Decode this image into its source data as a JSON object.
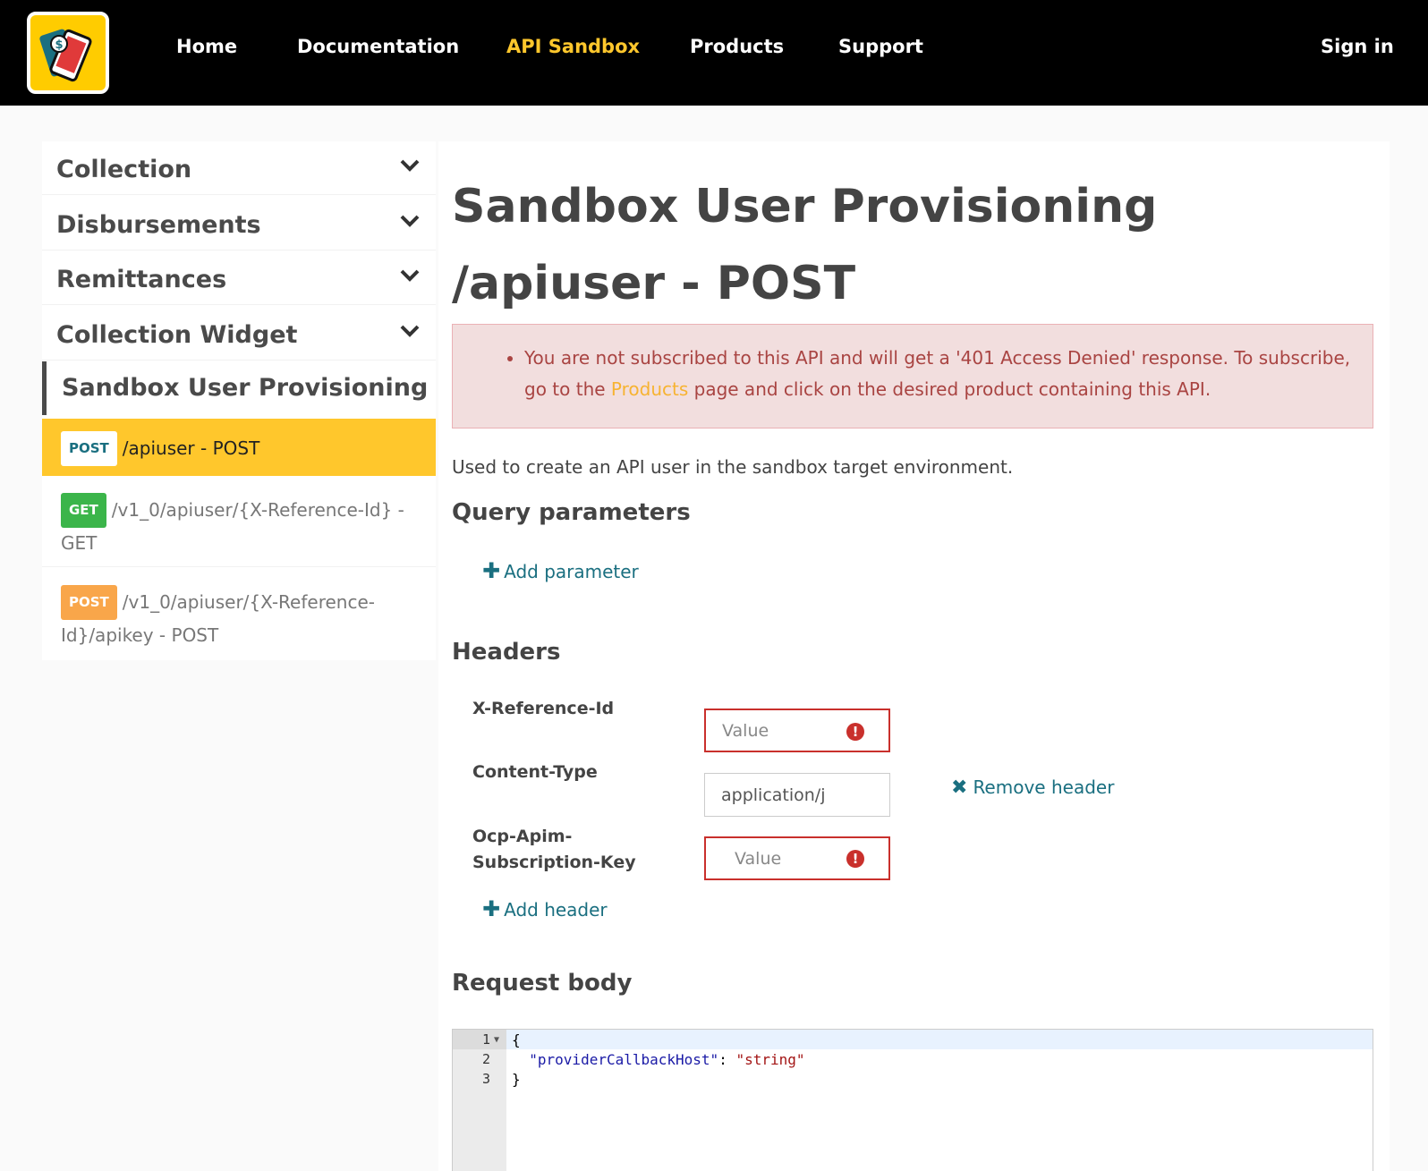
{
  "nav": {
    "items": [
      {
        "label": "Home",
        "active": false
      },
      {
        "label": "Documentation",
        "active": false
      },
      {
        "label": "API Sandbox",
        "active": true
      },
      {
        "label": "Products",
        "active": false
      },
      {
        "label": "Support",
        "active": false
      }
    ],
    "sign_in": "Sign in",
    "active_color": "#ffc72c"
  },
  "sidebar": {
    "groups": [
      {
        "label": "Collection",
        "icon": "chevron-down-icon"
      },
      {
        "label": "Disbursements",
        "icon": "chevron-down-icon"
      },
      {
        "label": "Remittances",
        "icon": "chevron-down-icon"
      },
      {
        "label": "Collection Widget",
        "icon": "chevron-down-icon"
      }
    ],
    "current_group": "Sandbox User Provisioning",
    "operations": [
      {
        "method": "POST",
        "path": "/apiuser - POST",
        "selected": true
      },
      {
        "method": "GET",
        "path": "/v1_0/apiuser/{X-Reference-Id} - GET",
        "selected": false
      },
      {
        "method": "POST",
        "path": "/v1_0/apiuser/{X-Reference-Id}/apikey - POST",
        "selected": false
      }
    ]
  },
  "main": {
    "title": "Sandbox User Provisioning /apiuser - POST",
    "alert": {
      "before": "You are not subscribed to this API and will get a '401 Access Denied' response. To subscribe, go to the ",
      "link": "Products",
      "after": " page and click on the desired product containing this API."
    },
    "description": "Used to create an API user in the sandbox target environment.",
    "query_heading": "Query parameters",
    "add_parameter": "Add parameter",
    "headers_heading": "Headers",
    "headers": [
      {
        "name": "X-Reference-Id",
        "value": "",
        "placeholder": "Value",
        "error": true
      },
      {
        "name": "Content-Type",
        "value": "application/j",
        "placeholder": "",
        "error": false
      },
      {
        "name": "Ocp-Apim-Subscription-Key",
        "value": "",
        "placeholder": "Value",
        "error": true
      }
    ],
    "remove_header": "Remove header",
    "add_header": "Add header",
    "body_heading": "Request body",
    "code_lines": [
      {
        "n": "1",
        "text": "{"
      },
      {
        "n": "2",
        "key": "\"providerCallbackHost\"",
        "sep": ": ",
        "val": "\"string\""
      },
      {
        "n": "3",
        "text": "}"
      }
    ]
  }
}
